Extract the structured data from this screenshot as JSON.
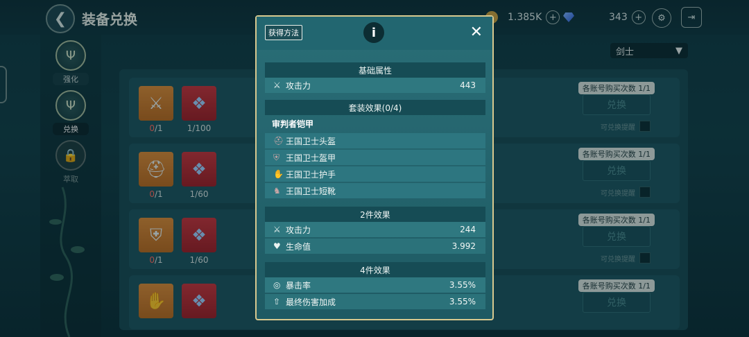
{
  "header": {
    "back_icon": "arrow-left-icon",
    "title": "装备兑换",
    "gold": "1.385K",
    "gems": "343"
  },
  "sidebar": {
    "items": [
      {
        "label": "强化",
        "icon": "trident-icon"
      },
      {
        "label": "兑换",
        "icon": "trident-icon"
      },
      {
        "label": "萃取",
        "icon": "lock-icon"
      }
    ]
  },
  "class_select": {
    "value": "剑士"
  },
  "list": {
    "rows": [
      {
        "a_count_have": "0",
        "a_count_need": "1",
        "b_count_have": "1",
        "b_count_need": "100",
        "buy_limit": "各账号购买次数 1/1",
        "exchange_label": "兑换",
        "remind_label": "可兑换提醒"
      },
      {
        "a_count_have": "0",
        "a_count_need": "1",
        "b_count_have": "1",
        "b_count_need": "60",
        "buy_limit": "各账号购买次数 1/1",
        "exchange_label": "兑换",
        "remind_label": "可兑换提醒"
      },
      {
        "a_count_have": "0",
        "a_count_need": "1",
        "b_count_have": "1",
        "b_count_need": "60",
        "buy_limit": "各账号购买次数 1/1",
        "exchange_label": "兑换",
        "remind_label": "可兑换提醒"
      },
      {
        "buy_limit": "各账号购买次数 1/1",
        "exchange_label": "兑换"
      }
    ]
  },
  "modal": {
    "source_button": "获得方法",
    "base_section": {
      "title": "基础属性",
      "stat_label": "攻击力",
      "stat_value": "443"
    },
    "set_section": {
      "title": "套装效果(0/4)",
      "set_name": "审判者铠甲",
      "pieces": [
        "王国卫士头盔",
        "王国卫士盔甲",
        "王国卫士护手",
        "王国卫士短靴"
      ]
    },
    "two_piece": {
      "title": "2件效果",
      "stats": [
        {
          "label": "攻击力",
          "value": "244"
        },
        {
          "label": "生命值",
          "value": "3.992"
        }
      ]
    },
    "four_piece": {
      "title": "4件效果",
      "stats": [
        {
          "label": "暴击率",
          "value": "3.55%"
        },
        {
          "label": "最终伤害加成",
          "value": "3.55%"
        }
      ]
    }
  },
  "colors": {
    "modal_border": "#d8c98f",
    "item_orange": "#d98a37",
    "item_red": "#c6343c",
    "count_highlight": "#ff6b5e"
  }
}
